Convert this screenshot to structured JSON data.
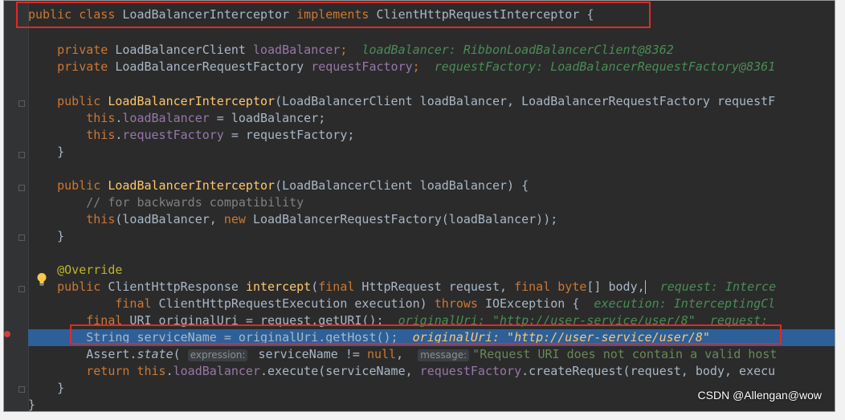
{
  "code": {
    "class_decl": {
      "public": "public",
      "class": "class",
      "name": "LoadBalancerInterceptor",
      "implements": "implements",
      "iface": "ClientHttpRequestInterceptor",
      "brace": "{"
    },
    "field1": {
      "mod": "private",
      "type": "LoadBalancerClient",
      "name": "loadBalancer",
      "semi": ";",
      "hint": "loadBalancer: RibbonLoadBalancerClient@8362"
    },
    "field2": {
      "mod": "private",
      "type": "LoadBalancerRequestFactory",
      "name": "requestFactory",
      "semi": ";",
      "hint": "requestFactory: LoadBalancerRequestFactory@8361"
    },
    "ctor1_sig": {
      "mod": "public",
      "name": "LoadBalancerInterceptor",
      "params": "(LoadBalancerClient loadBalancer, LoadBalancerRequestFactory requestF"
    },
    "ctor1_b1": {
      "this": "this",
      "dot": ".",
      "field": "loadBalancer",
      "rest": " = loadBalancer;"
    },
    "ctor1_b2": {
      "this": "this",
      "dot": ".",
      "field": "requestFactory",
      "rest": " = requestFactory;"
    },
    "close1": "}",
    "ctor2_sig": {
      "mod": "public",
      "name": "LoadBalancerInterceptor",
      "params": "(LoadBalancerClient loadBalancer) {"
    },
    "ctor2_comment": "// for backwards compatibility",
    "ctor2_b1": {
      "this": "this",
      "a": "(loadBalancer, ",
      "new": "new",
      "b": " LoadBalancerRequestFactory(loadBalancer));"
    },
    "close2": "}",
    "annotation": "@Override",
    "m_sig": {
      "mod": "public",
      "type": "ClientHttpResponse",
      "name": "intercept",
      "p1": "(",
      "final1": "final",
      "p2": " HttpRequest request, ",
      "final2": "final",
      "byte": "byte",
      "p3": "[] body,",
      "hint": "request: Interce"
    },
    "m_sig2": {
      "final": "final",
      "p": " ClientHttpRequestExecution execution) ",
      "throws": "throws",
      "ex": " IOException {",
      "hint": "execution: InterceptingCl"
    },
    "m_b1": {
      "final": "final",
      "a": " URI originalUri = request.getURI();",
      "hint": "originalUri: \"http://user-service/user/8\"  request: "
    },
    "m_b2": {
      "a": "String serviceName = originalUri.getHost();",
      "hint": "originalUri: \"http://user-service/user/8\""
    },
    "m_b3": {
      "a": "Assert.",
      "state": "state",
      "b": "(",
      "h1": "expression:",
      "c": " serviceName != ",
      "null": "null",
      "d": ", ",
      "h2": "message:",
      "e": "\"Request URI does not contain a valid host"
    },
    "m_b4": {
      "return": "return",
      "this": "this",
      "dot": ".",
      "field": "loadBalancer",
      "a": ".execute(serviceName, ",
      "field2": "requestFactory",
      "b": ".createRequest(request, body, execu"
    },
    "close3": "}",
    "close4": "}"
  },
  "watermark": "CSDN @Allengan@wow"
}
